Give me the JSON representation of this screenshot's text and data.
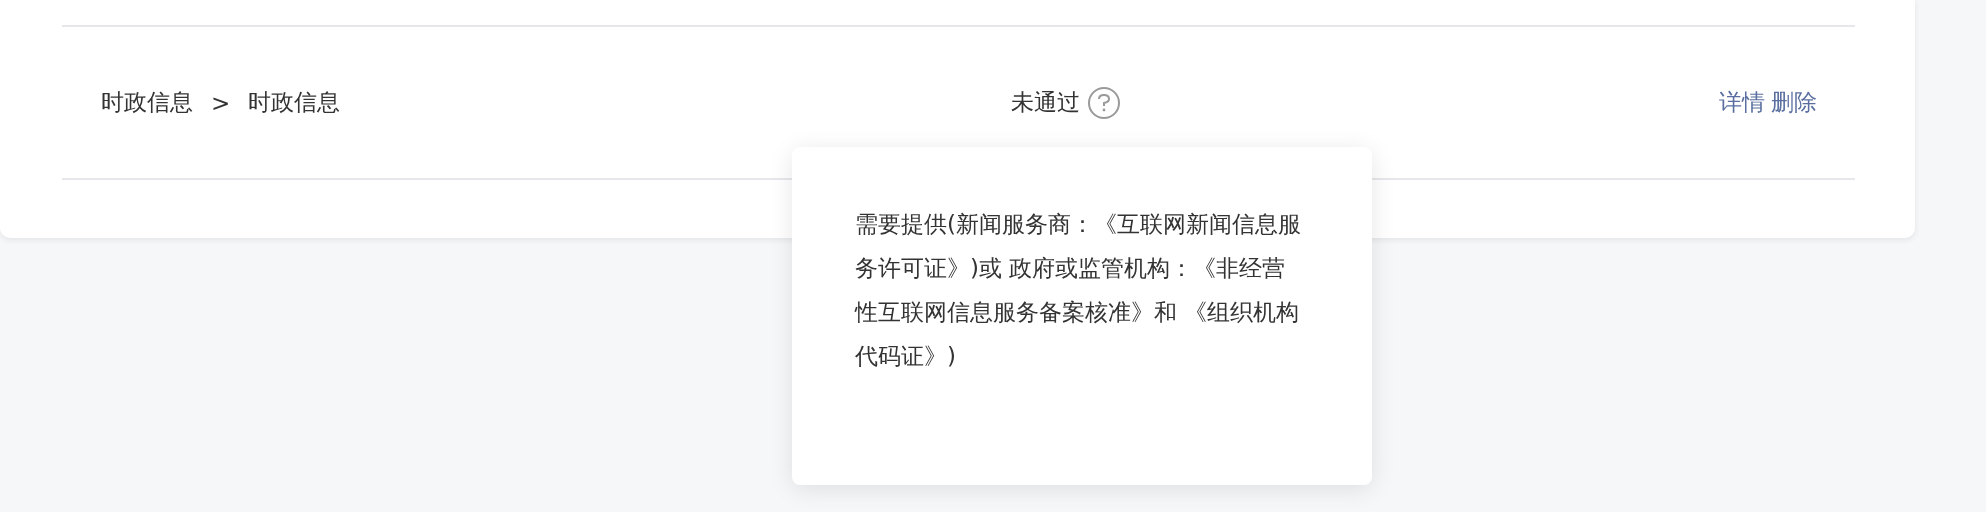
{
  "row": {
    "category": "时政信息",
    "separator": ">",
    "subcategory": "时政信息",
    "status": "未通过",
    "actions": [
      {
        "label": "详情"
      },
      {
        "label": "删除"
      }
    ]
  },
  "tooltip": {
    "text": "需要提供(新闻服务商：《互联网新闻信息服务许可证》)或 政府或监管机构：《非经营性互联网信息服务备案核准》和 《组织机构代码证》)"
  }
}
